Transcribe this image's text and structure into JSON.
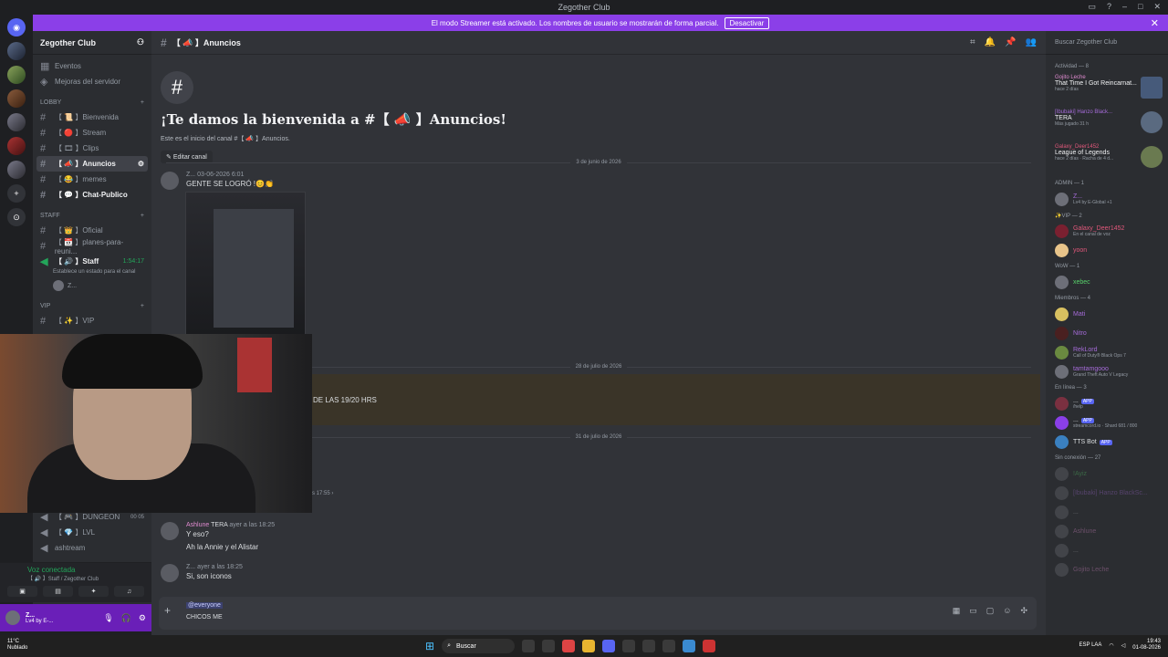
{
  "window": {
    "title": "Zegother Club"
  },
  "banner": {
    "text": "El modo Streamer está activado. Los nombres de usuario se mostrarán de forma parcial.",
    "button": "Desactivar"
  },
  "server": {
    "name": "Zegother Club",
    "top_items": [
      "Eventos",
      "Mejoras del servidor"
    ],
    "categories": [
      {
        "name": "LOBBY",
        "channels": [
          "【 📜 】Bienvenida",
          "【 🔴 】Stream",
          "【 🎞 】Clips",
          "【 📣 】Anuncios",
          "【 😂 】memes",
          "【 💬 】Chat-Publico"
        ]
      },
      {
        "name": "STAFF",
        "channels": [
          "【 👑 】Oficial",
          "【 📆 】planes-para-reuni...",
          "【 🔊 】Staff"
        ]
      },
      {
        "name": "VIP",
        "channels": [
          "【 ✨ 】VIP"
        ]
      }
    ],
    "staff_timer": "1:54:17",
    "staff_status": "Establece un estado para el canal",
    "staff_user": "Z...",
    "lower_channels": [
      "【 🎮 】DUNGEON",
      "【 💎 】LVL",
      "ashtream"
    ],
    "dungeon_count": "00 05"
  },
  "voice": {
    "status": "Voz conectada",
    "location": "【 🔊 】Staff / Zegother Club"
  },
  "user": {
    "name": "Z...",
    "status": "Lv4 by E-..."
  },
  "channel": {
    "name": "【 📣 】Anuncios",
    "welcome_title": "¡Te damos la bienvenida a #【 📣 】Anuncios!",
    "welcome_desc": "Este es el inicio del canal #【 📣 】Anuncios.",
    "edit_button": "Editar canal"
  },
  "messages": {
    "date1": "3 de junio de 2026",
    "msg1_author": "Z...",
    "msg1_time": "03-06-2026 6:01",
    "msg1_text": "GENTE SE LOGRÓ !😊👏",
    "date2": "28 de julio de 2026",
    "pinned_text": "DE LAS 19/20 HRS",
    "date3": "31 de julio de 2026",
    "partial_time": "s 17:55 ›",
    "msg2_author": "Ashlune",
    "msg2_tag": "TERA",
    "msg2_time": "ayer a las 18:25",
    "msg2_line1": "Y eso?",
    "msg2_line2": "Ah la Annie y el Alistar",
    "msg3_author": "Z...",
    "msg3_time": "ayer a las 18:25",
    "msg3_text": "Si, son iconos"
  },
  "composer": {
    "mention": "@everyone",
    "typed": "CHICOS ME"
  },
  "members": {
    "search_placeholder": "Buscar Zegother Club",
    "activity_header": "Actividad — 8",
    "activities": [
      {
        "name": "Gojito Leche",
        "game": "That Time I Got Reincarnat...",
        "status": "hace 2 días"
      },
      {
        "name": "[Ibubaki] Hanzo Black...",
        "game": "TERA",
        "status": "Más jugado 31 h"
      },
      {
        "name": "Galaxy_Deer1452",
        "game": "League of Legends",
        "status": "hace 2 días · Racha de 4 d..."
      }
    ],
    "groups": [
      {
        "header": "ADMIN — 1",
        "members": [
          {
            "name": "Z...",
            "status": "Lv4 by E-Global +1"
          }
        ]
      },
      {
        "header": "✨VIP — 2",
        "members": [
          {
            "name": "Galaxy_Deer1452",
            "status": "En el canal de voz"
          },
          {
            "name": "yoon",
            "status": ""
          }
        ]
      },
      {
        "header": "WoW — 1",
        "members": [
          {
            "name": "xebec",
            "status": ""
          }
        ]
      },
      {
        "header": "Miembros — 4",
        "members": [
          {
            "name": "Mati",
            "status": ""
          },
          {
            "name": "Nitro",
            "status": ""
          },
          {
            "name": "RekLord",
            "status": "Call of Duty® Black Ops 7"
          },
          {
            "name": "tamtamgooo",
            "status": "Grand Theft Auto V Legacy"
          }
        ]
      },
      {
        "header": "En línea — 3",
        "members": [
          {
            "name": "...",
            "status": "/help",
            "tag": "APP"
          },
          {
            "name": "...",
            "status": "streamcord.io · Shard 681 / 800",
            "tag": "APP"
          },
          {
            "name": "TTS Bot",
            "status": "",
            "tag": "APP"
          }
        ]
      },
      {
        "header": "Sin conexión — 27",
        "members": [
          {
            "name": "!Ayiz"
          },
          {
            "name": "[Ibubaki] Hanzo BlackSc..."
          },
          {
            "name": "..."
          },
          {
            "name": "Ashlune"
          },
          {
            "name": "..."
          },
          {
            "name": "Gojito Leche"
          }
        ]
      }
    ]
  },
  "taskbar": {
    "temp": "11°C",
    "weather": "Nublado",
    "search": "Buscar",
    "lang": "ESP LAA",
    "time": "19:43",
    "date": "01-08-2026"
  }
}
